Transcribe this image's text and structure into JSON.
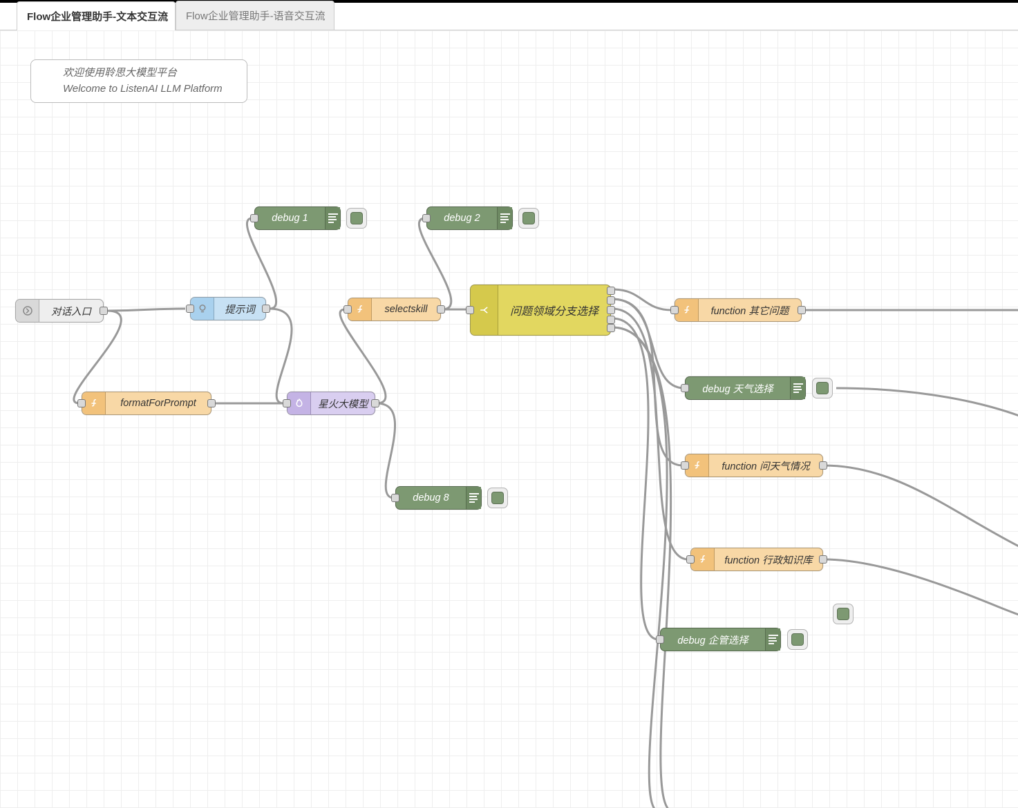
{
  "tabs": {
    "active": "Flow企业管理助手-文本交互流",
    "inactive": "Flow企业管理助手-语音交互流"
  },
  "comment": {
    "line1": "欢迎使用聆思大模型平台",
    "line2": "Welcome to ListenAI LLM Platform"
  },
  "nodes": {
    "entry": {
      "label": "对话入口"
    },
    "prompt": {
      "label": "提示词"
    },
    "formatForPrompt": {
      "label": "formatForPrompt"
    },
    "spark": {
      "label": "星火大模型"
    },
    "selectskill": {
      "label": "selectskill"
    },
    "switch": {
      "label": "问题领域分支选择"
    },
    "fnOther": {
      "label": "function 其它问题"
    },
    "fnWeather": {
      "label": "function 问天气情况"
    },
    "fnAdmin": {
      "label": "function 行政知识库"
    },
    "debug1": {
      "label": "debug 1"
    },
    "debug2": {
      "label": "debug 2"
    },
    "debug8": {
      "label": "debug 8"
    },
    "debugWeather": {
      "label": "debug 天气选择"
    },
    "debugEnterprise": {
      "label": "debug 企管选择"
    }
  }
}
